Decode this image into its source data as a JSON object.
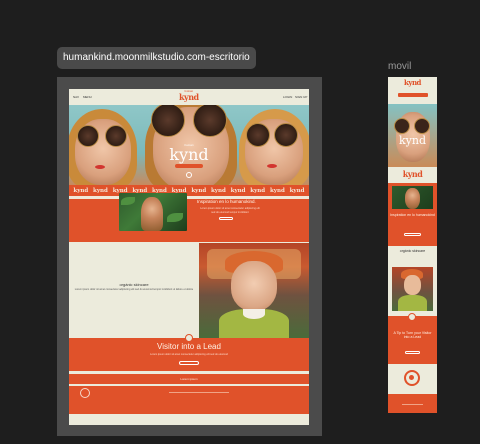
{
  "desktop": {
    "label": "humankind.moonmilkstudio.com-escritorio",
    "nav": {
      "left": [
        "NAV",
        "MENU"
      ],
      "right": [
        "LOGIN",
        "SIGN UP"
      ]
    },
    "logo": {
      "main": "kynd",
      "small": "human"
    },
    "hero": {
      "logo": "kynd",
      "small": "human"
    },
    "strip_logos": [
      "kynd",
      "kynd",
      "kynd",
      "kynd",
      "kynd",
      "kynd",
      "kynd",
      "kynd",
      "kynd",
      "kynd",
      "kynd",
      "kynd"
    ],
    "section1": {
      "title": "Inspiration en lo humanokind.",
      "text": "Lorem ipsum dolor sit amet consectetur adipiscing elit sed do eiusmod tempor incididunt"
    },
    "section2": {
      "title": "orgánic skincare",
      "text": "Lorem ipsum dolor sit amet consectetur adipiscing elit sed do eiusmod tempor incididunt ut labore et dolore"
    },
    "section3": {
      "title": "Visitor into a Lead",
      "text": "Lorem ipsum dolor sit amet consectetur adipiscing elit sed do eiusmod"
    },
    "section4": {
      "text": "Lorem ipsum"
    }
  },
  "mobile": {
    "label": "movil",
    "logo": "kynd",
    "hero_logo": "kynd",
    "strip_logo": "kynd",
    "section1_title": "Inspiration en lo humanokind",
    "section2_title": "orgánic skincare",
    "section3_title": "A Tip to Turn your Visitor into a Lead"
  },
  "colors": {
    "accent": "#e0522a",
    "cream": "#ecebdc",
    "canvas": "#1e1e1e"
  }
}
